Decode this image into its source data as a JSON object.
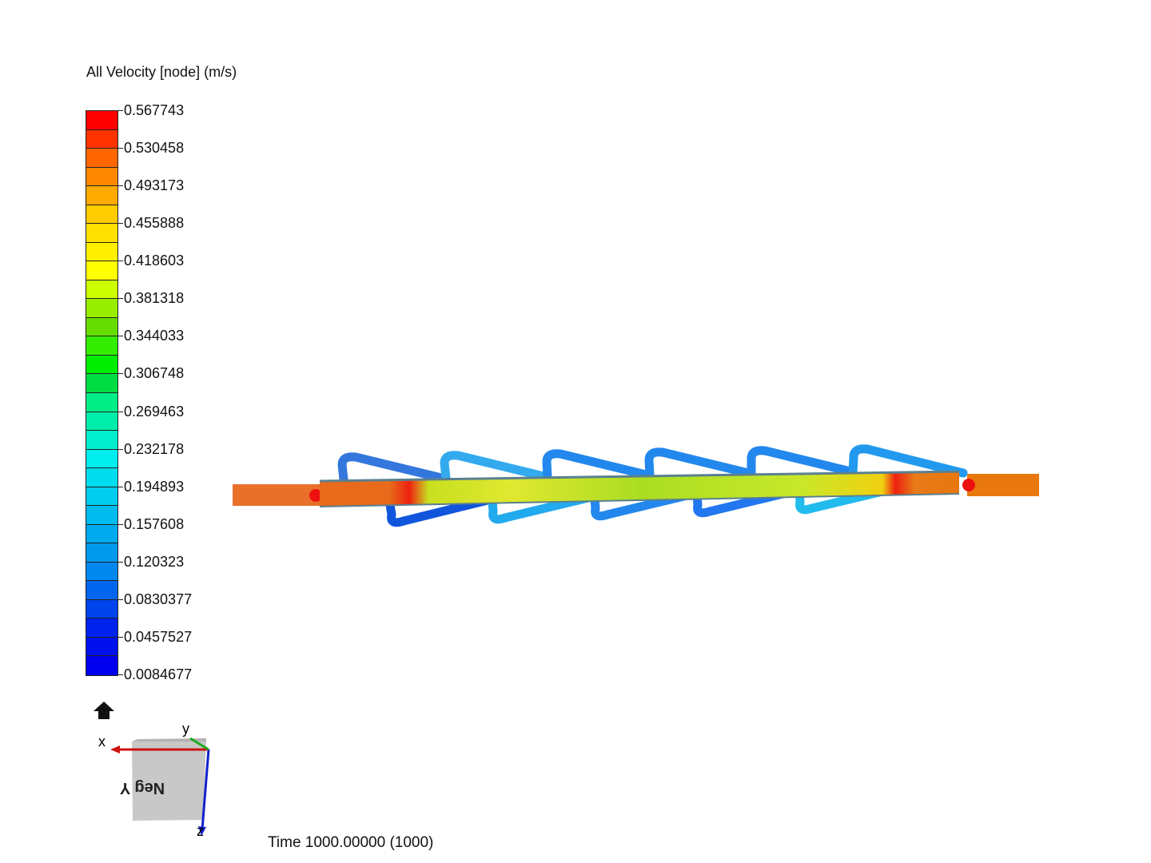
{
  "legend": {
    "title": "All Velocity [node] (m/s)",
    "ticks": [
      "0.567743",
      "0.530458",
      "0.493173",
      "0.455888",
      "0.418603",
      "0.381318",
      "0.344033",
      "0.306748",
      "0.269463",
      "0.232178",
      "0.194893",
      "0.157608",
      "0.120323",
      "0.0830377",
      "0.0457527",
      "0.0084677"
    ],
    "colors": [
      "#ff0000",
      "#ff3300",
      "#ff6600",
      "#ff8800",
      "#ffaa00",
      "#ffcc00",
      "#ffe000",
      "#fff000",
      "#ffff00",
      "#ccff00",
      "#99ee00",
      "#66dd00",
      "#33ee00",
      "#00ee00",
      "#00dd44",
      "#00ee88",
      "#00eeaa",
      "#00eecc",
      "#00eeee",
      "#00ddee",
      "#00ccee",
      "#00bbee",
      "#00aaee",
      "#0099ee",
      "#0088ee",
      "#0066ee",
      "#0044ee",
      "#0022ee",
      "#0011ee",
      "#0000ee"
    ]
  },
  "triad": {
    "x_label": "x",
    "y_label": "y",
    "z_label": "z",
    "face_label": "Neg Y"
  },
  "status": {
    "time": "Time 1000.00000 (1000)"
  },
  "icons": {
    "home": "home-icon"
  }
}
